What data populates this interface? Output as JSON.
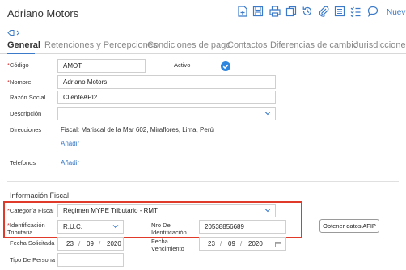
{
  "header": {
    "title": "Adriano Motors",
    "new_label": "Nuev",
    "toolbar_icons": [
      "new-document-icon",
      "save-icon",
      "print-icon",
      "copy-icon",
      "history-icon",
      "attach-icon",
      "list-icon",
      "checklist-icon",
      "comment-icon"
    ]
  },
  "tabs": [
    "General",
    "Retenciones y Percepciones",
    "Condiciones de pago",
    "Contactos",
    "Diferencias de cambio",
    "Jurisdicciones"
  ],
  "form": {
    "codigo_label": "Código",
    "codigo_value": "AMOT",
    "activo_label": "Activo",
    "nombre_label": "Nombre",
    "nombre_value": "Adriano Motors",
    "razon_label": "Razón Social",
    "razon_value": "ClienteAPI2",
    "descripcion_label": "Descripción",
    "direcciones_label": "Direcciones",
    "direccion_value": "Fiscal: Mariscal de la Mar 602, Miraflores, Lima, Perú",
    "add_address_link": "Añadir",
    "telefonos_label": "Telefonos",
    "add_phone_link": "Añadir"
  },
  "fiscal": {
    "section_title": "Información Fiscal",
    "categoria_label": "Categoría Fiscal",
    "categoria_value": "Régimen MYPE Tributario - RMT",
    "ident_label_1": "Identificación",
    "ident_label_2": "Tributaria",
    "ident_value": "R.U.C.",
    "nro_label_1": "Nro De",
    "nro_label_2": "Identificación",
    "nro_value": "20538856689",
    "afip_button": "Obtener datos AFIP",
    "fecha_sol_label": "Fecha Solicitada",
    "fecha_sol": {
      "d": "23",
      "m": "09",
      "y": "2020"
    },
    "fecha_venc_label_1": "Fecha",
    "fecha_venc_label_2": "Vencimiento",
    "fecha_venc": {
      "d": "23",
      "m": "09",
      "y": "2020"
    },
    "tipo_persona_label": "Tipo De Persona",
    "date_sep": "/"
  },
  "colors": {
    "accent": "#3a7ac8",
    "required": "#d32f2f",
    "highlight": "#e03a2a"
  }
}
